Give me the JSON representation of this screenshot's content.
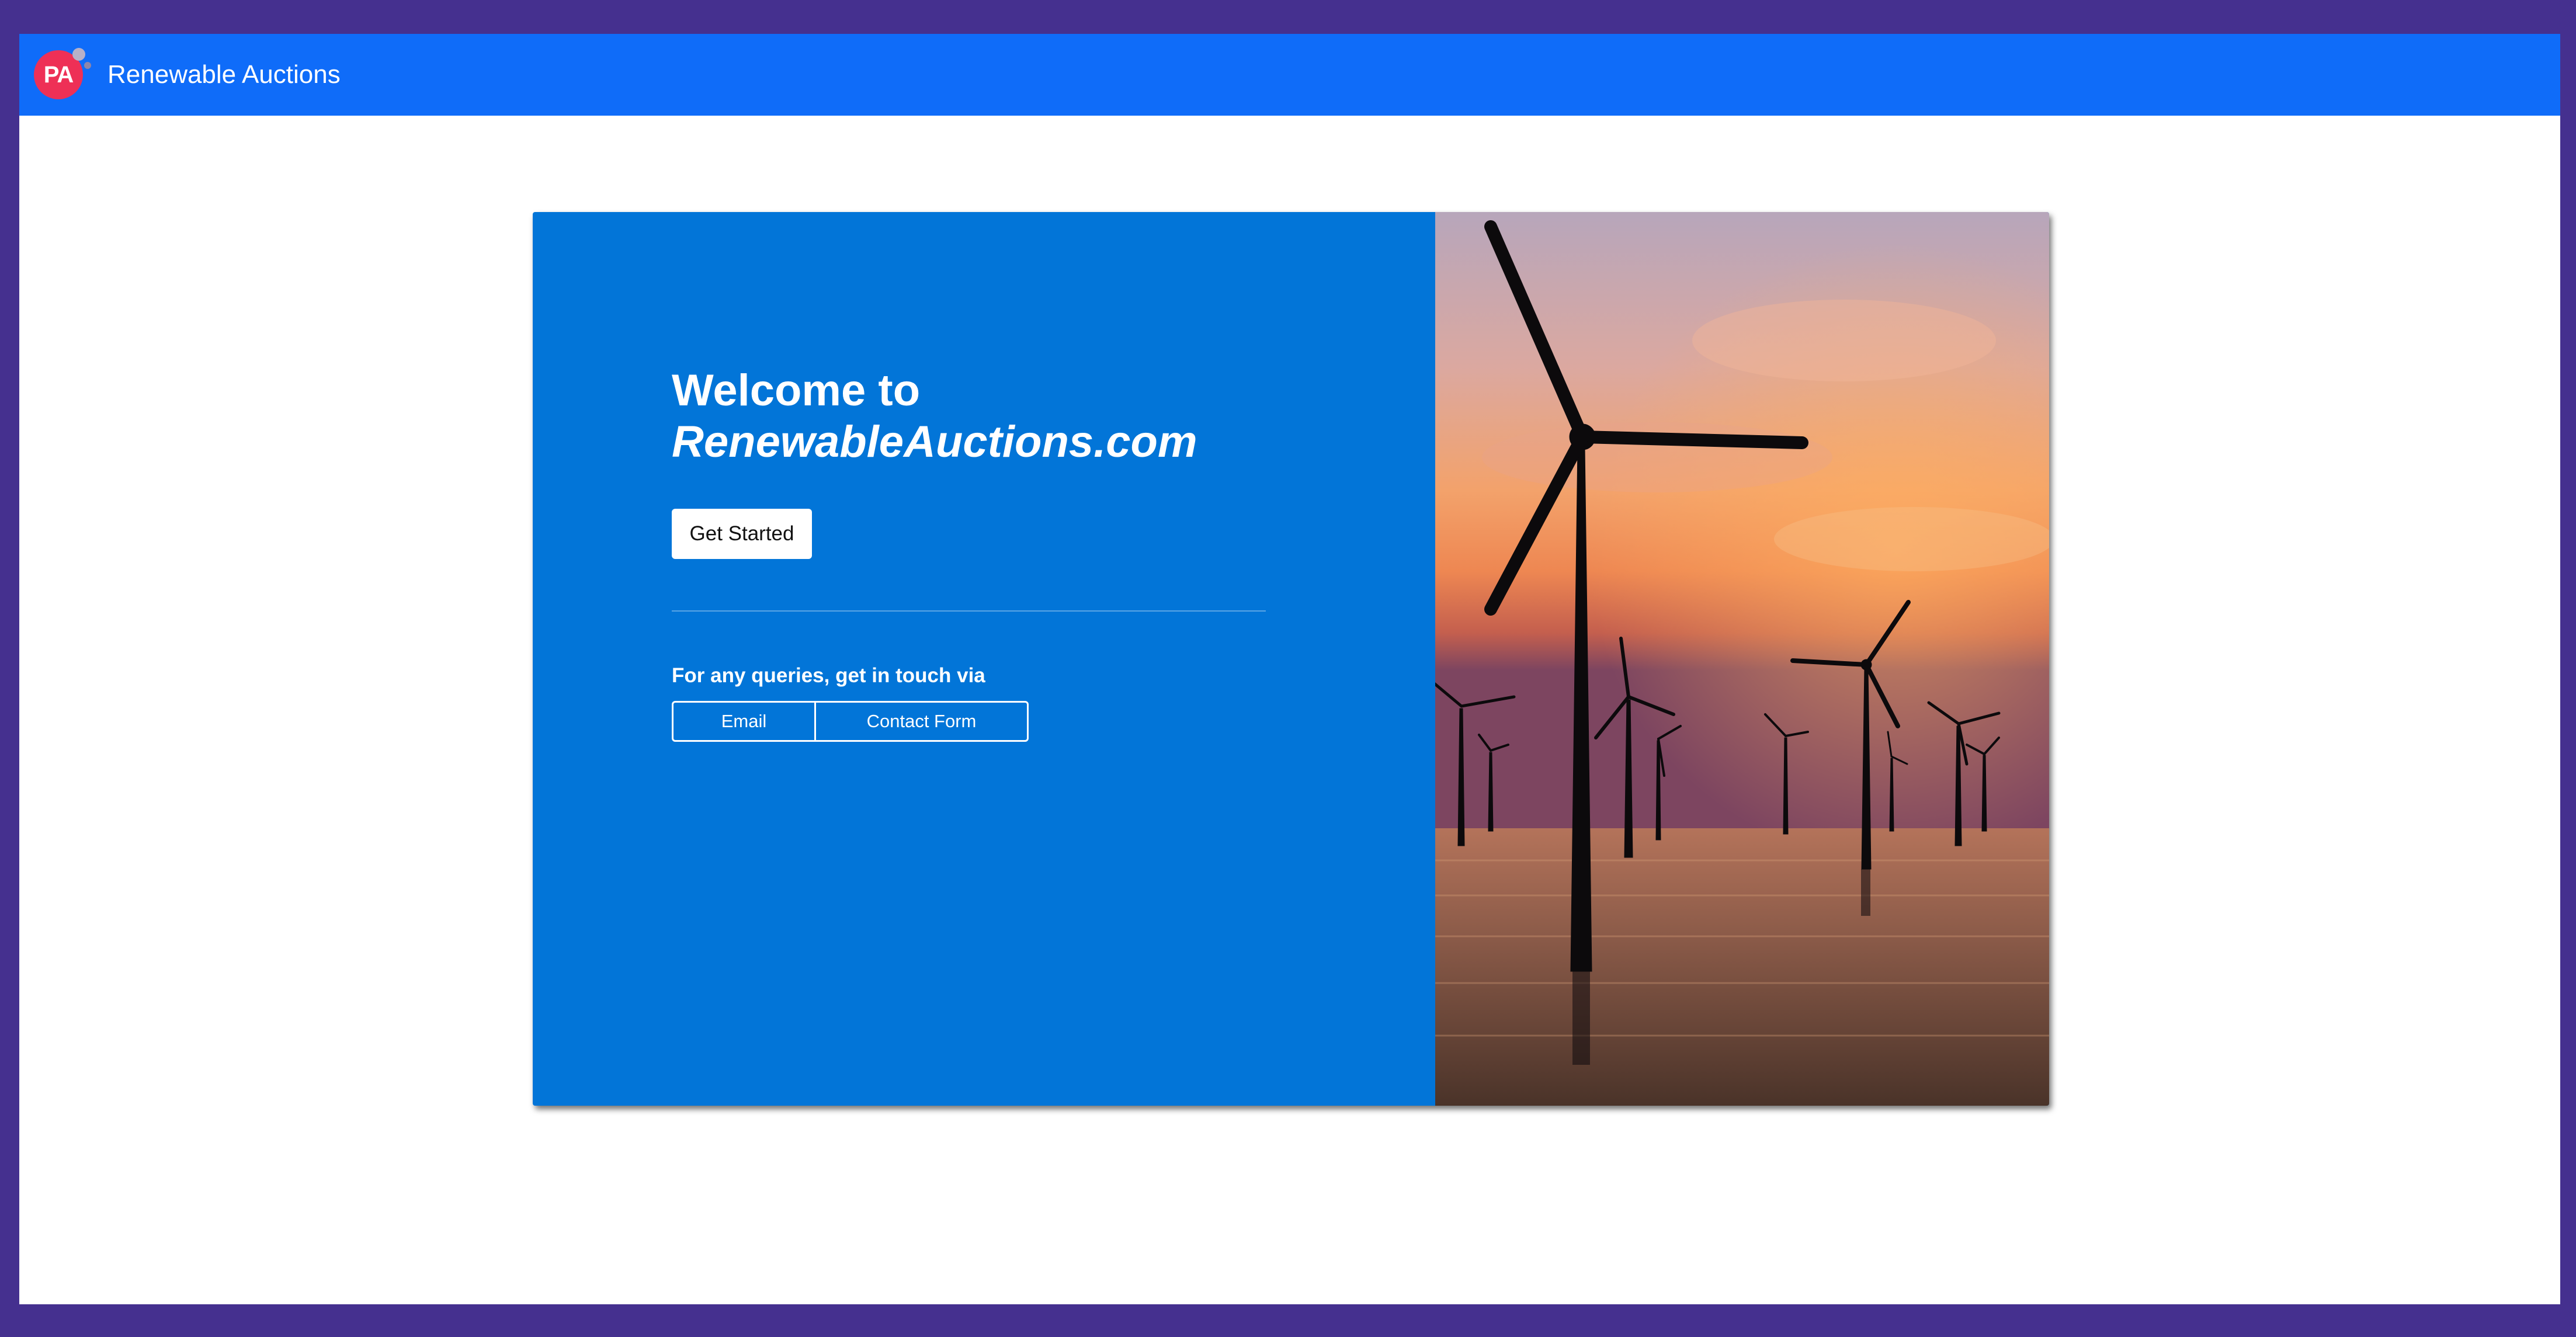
{
  "header": {
    "logo_text": "PA",
    "title": "Renewable Auctions"
  },
  "hero": {
    "welcome_line1": "Welcome to",
    "welcome_line2": "RenewableAuctions.com",
    "get_started_label": "Get Started",
    "queries_text": "For any queries, get in touch via",
    "email_label": "Email",
    "contact_form_label": "Contact Form",
    "image_icon": "wind-turbines-sunset-photo"
  },
  "colors": {
    "outer_frame": "#45308f",
    "header_bar": "#0f6cf9",
    "hero_panel": "#0275d8",
    "logo": "#ee3056"
  }
}
